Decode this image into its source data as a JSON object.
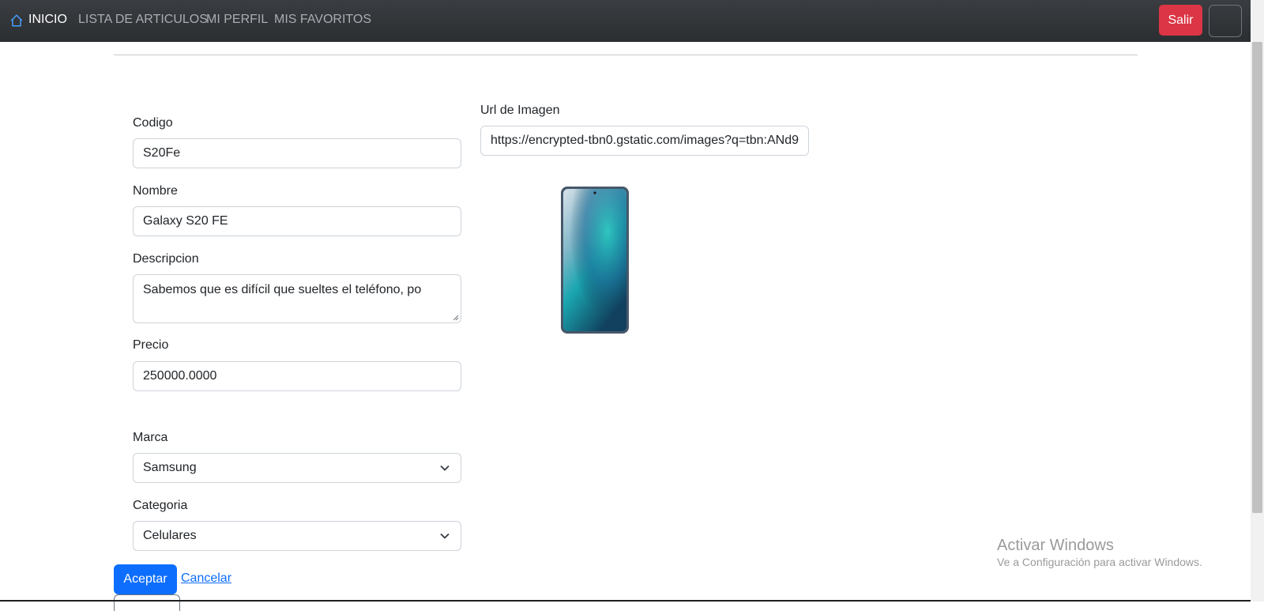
{
  "navbar": {
    "home_icon": "house-icon",
    "items": [
      "INICIO",
      "LISTA DE ARTICULOS",
      "MI PERFIL",
      "MIS FAVORITOS"
    ],
    "logout_label": "Salir"
  },
  "form": {
    "codigo": {
      "label": "Codigo",
      "value": "S20Fe"
    },
    "nombre": {
      "label": "Nombre",
      "value": "Galaxy S20 FE"
    },
    "descripcion": {
      "label": "Descripcion",
      "value": "Sabemos que es difícil que sueltes el teléfono, po"
    },
    "precio": {
      "label": "Precio",
      "value": "250000.0000"
    },
    "marca": {
      "label": "Marca",
      "value": "Samsung"
    },
    "categoria": {
      "label": "Categoria",
      "value": "Celulares"
    },
    "url_imagen": {
      "label": "Url de Imagen",
      "value": "https://encrypted-tbn0.gstatic.com/images?q=tbn:ANd9"
    }
  },
  "actions": {
    "accept_label": "Aceptar",
    "cancel_label": "Cancelar"
  },
  "watermark": {
    "title": "Activar Windows",
    "subtitle": "Ve a Configuración para activar Windows."
  },
  "colors": {
    "navbar": "#2f3235",
    "danger": "#dc3545",
    "primary": "#0d6efd"
  }
}
